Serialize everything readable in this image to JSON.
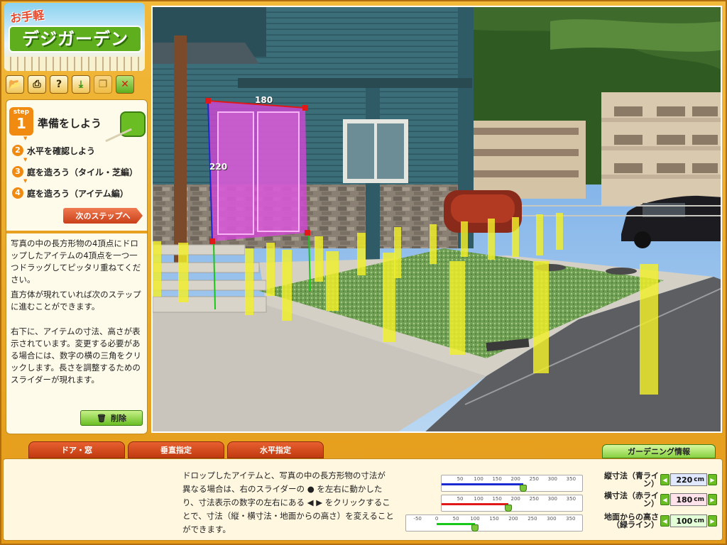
{
  "logo": {
    "small": "お手軽",
    "big": "デジガーデン"
  },
  "toolbar": [
    "folder-icon",
    "print-icon",
    "help-icon",
    "save-icon",
    "window-icon",
    "close-icon"
  ],
  "step": {
    "badge_label": "step",
    "badge_num": "1",
    "title": "準備をしよう"
  },
  "steps": [
    {
      "num": "2",
      "label": "水平を確認しよう"
    },
    {
      "num": "3",
      "label": "庭を造ろう（タイル・芝編）"
    },
    {
      "num": "4",
      "label": "庭を造ろう（アイテム編）"
    }
  ],
  "next_button": "次のステップへ",
  "paragraphs": [
    "写真の中の長方形物の4頂点にドロップしたアイテムの4頂点を一つ一つドラッグしてピッタリ重ねてください。",
    "直方体が現れていれば次のステップに進むことができます。",
    "右下に、アイテムの寸法、高さが表示されています。変更する必要がある場合には、数字の横の三角をクリックします。長さを調整するためのスライダーが現れます。"
  ],
  "delete_button": "削除",
  "item_labels": {
    "width": "180",
    "height": "220"
  },
  "tabs": [
    "ドア・窓",
    "垂直指定",
    "水平指定"
  ],
  "garden_info": "ガーデニング情報",
  "bottom_text": "ドロップしたアイテムと、写真の中の長方形物の寸法が 異なる場合は、右のスライダーの ● を左右に動かしたり、寸法表示の数字の左右にある ◀ ▶ をクリックすることで、寸法（縦・横寸法・地面からの高さ）を変えることができます。",
  "rulers": [
    {
      "ticks": [
        "50",
        "100",
        "150",
        "200",
        "250",
        "300",
        "350"
      ],
      "color": "#1a2ad0",
      "value": 220,
      "min": 0,
      "max": 380
    },
    {
      "ticks": [
        "50",
        "100",
        "150",
        "200",
        "250",
        "300",
        "350"
      ],
      "color": "#e01818",
      "value": 180,
      "min": 0,
      "max": 380
    },
    {
      "ticks": [
        "-50",
        "0",
        "50",
        "100",
        "150",
        "200",
        "250",
        "300",
        "350"
      ],
      "color": "#18c818",
      "value": 100,
      "min": -80,
      "max": 380
    }
  ],
  "dimensions": [
    {
      "label": "縦寸法（青ライン）",
      "value": "220",
      "unit": "cm",
      "bg": "#dfe8ff"
    },
    {
      "label": "横寸法（赤ライン）",
      "value": "180",
      "unit": "cm",
      "bg": "#ffe2ea"
    },
    {
      "label": "地面からの高さ（緑ライン）",
      "value": "100",
      "unit": "cm",
      "bg": "#e2ffd8"
    }
  ]
}
